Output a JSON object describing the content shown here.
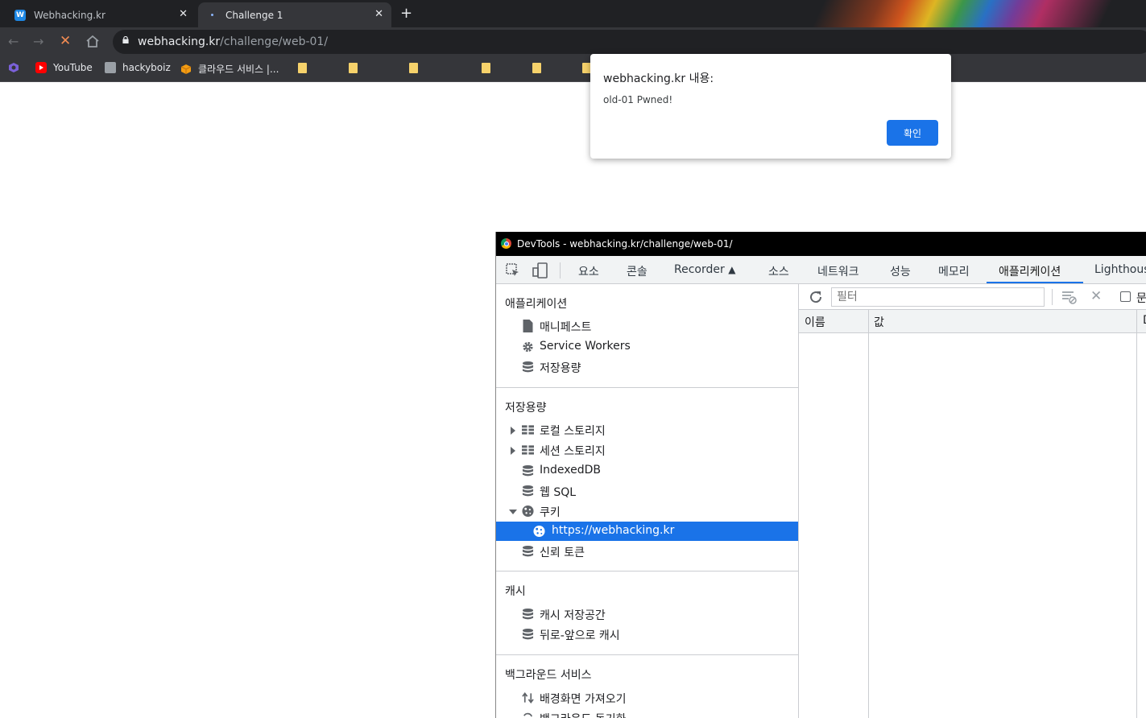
{
  "browser": {
    "tabs": [
      {
        "title": "Webhacking.kr",
        "favicon": "w-icon"
      },
      {
        "title": "Challenge 1",
        "favicon": "loading-dot-icon"
      }
    ],
    "url_host": "webhacking.kr",
    "url_path": "/challenge/web-01/",
    "bookmarks": [
      {
        "label": "",
        "icon": "app-icon"
      },
      {
        "label": "YouTube",
        "icon": "youtube-icon"
      },
      {
        "label": "hackyboiz",
        "icon": "image-icon"
      },
      {
        "label": "클라우드 서비스 |...",
        "icon": "cube-icon"
      }
    ]
  },
  "alert": {
    "title": "webhacking.kr 내용:",
    "message": "old-01 Pwned!",
    "ok_label": "확인"
  },
  "devtools": {
    "window_title": "DevTools - webhacking.kr/challenge/web-01/",
    "tabs": [
      "요소",
      "콘솔",
      "Recorder",
      "소스",
      "네트워크",
      "성능",
      "메모리",
      "애플리케이션",
      "Lighthous"
    ],
    "active_tab": "애플리케이션",
    "sidebar": {
      "app_header": "애플리케이션",
      "app_items": [
        "매니페스트",
        "Service Workers",
        "저장용량"
      ],
      "storage_header": "저장용량",
      "storage_items": [
        "로컬 스토리지",
        "세션 스토리지",
        "IndexedDB",
        "웹 SQL",
        "쿠키",
        "https://webhacking.kr",
        "신뢰 토큰"
      ],
      "cache_header": "캐시",
      "cache_items": [
        "캐시 저장공간",
        "뒤로-앞으로 캐시"
      ],
      "bg_header": "백그라운드 서비스",
      "bg_items": [
        "배경화면 가져오기",
        "백그라운드 동기화"
      ]
    },
    "filter_placeholder": "필터",
    "checkbox_label": "문",
    "columns": [
      "이름",
      "값",
      "D"
    ]
  },
  "colors": {
    "accent": "#1a73e8",
    "tab_bar": "#202124",
    "toolbar": "#35363a"
  }
}
